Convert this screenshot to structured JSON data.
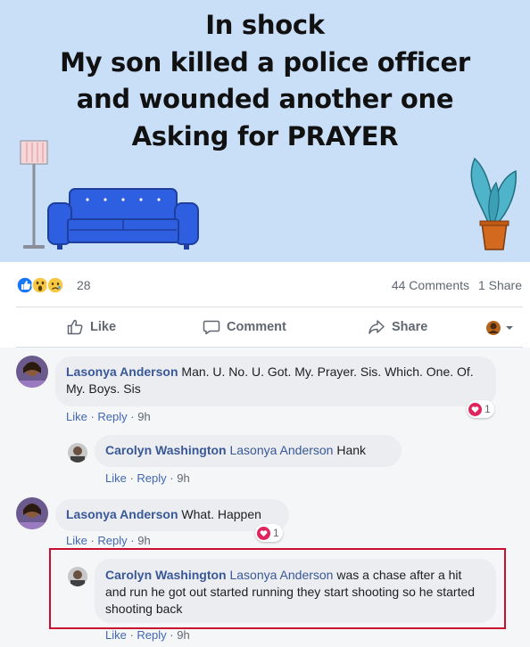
{
  "banner": {
    "lines": [
      "In shock",
      "My son killed a police officer",
      "and wounded another one",
      "Asking for PRAYER"
    ]
  },
  "stats": {
    "reaction_count": "28",
    "comments": "44 Comments",
    "shares": "1 Share",
    "reaction_icons": [
      "like-icon",
      "wow-icon",
      "sad-icon"
    ]
  },
  "actions": {
    "like": "Like",
    "comment": "Comment",
    "share": "Share"
  },
  "comments": [
    {
      "author": "Lasonya Anderson",
      "text": "Man. U. No. U. Got. My. Prayer. Sis. Which. One. Of. My. Boys. Sis",
      "like": "Like",
      "reply": "Reply",
      "time": "9h",
      "reactions": "1",
      "replies": [
        {
          "author": "Carolyn Washington",
          "mention": "Lasonya Anderson",
          "text": "Hank",
          "like": "Like",
          "reply": "Reply",
          "time": "9h"
        }
      ]
    },
    {
      "author": "Lasonya Anderson",
      "text": "What. Happen",
      "like": "Like",
      "reply": "Reply",
      "time": "9h",
      "reactions": "1",
      "replies": [
        {
          "author": "Carolyn Washington",
          "mention": "Lasonya Anderson",
          "text": "was a chase after a hit and run he got out started running they start shooting so he started shooting back",
          "like": "Like",
          "reply": "Reply",
          "time": "9h"
        }
      ]
    }
  ],
  "colors": {
    "banner_bg": "#c9def7",
    "link_blue": "#385898",
    "highlight_red": "#c8102e",
    "heart_red": "#e0245e"
  }
}
